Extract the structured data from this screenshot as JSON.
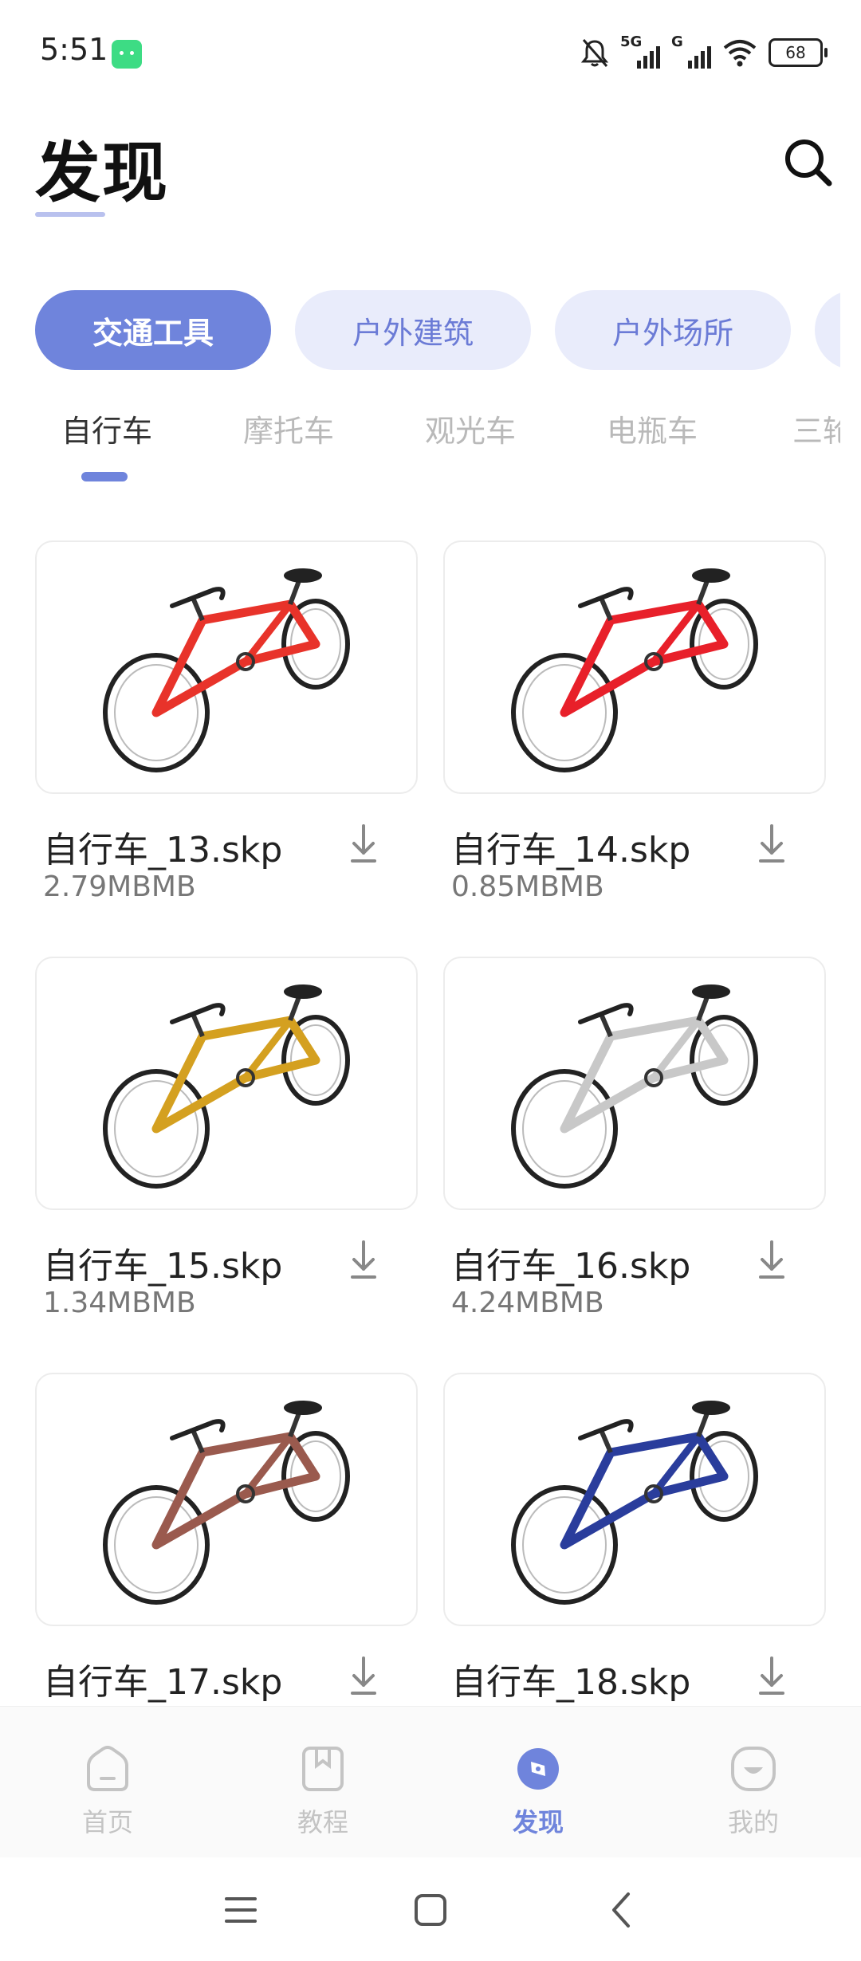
{
  "status_bar": {
    "time": "5:51",
    "sim1_label": "5G",
    "sim2_label": "G",
    "battery": "68",
    "icons": [
      "android-notification-icon",
      "mute-icon",
      "signal-icon",
      "wifi-icon",
      "battery-icon"
    ]
  },
  "header": {
    "title": "发现",
    "search_icon": "search-icon"
  },
  "categories": [
    {
      "label": "交通工具",
      "active": true
    },
    {
      "label": "户外建筑",
      "active": false
    },
    {
      "label": "户外场所",
      "active": false
    }
  ],
  "subtabs": [
    {
      "label": "自行车",
      "active": true
    },
    {
      "label": "摩托车",
      "active": false
    },
    {
      "label": "观光车",
      "active": false
    },
    {
      "label": "电瓶车",
      "active": false
    },
    {
      "label": "三轮",
      "active": false
    }
  ],
  "models": [
    {
      "name": "自行车_13.skp",
      "size": "2.79MBMB",
      "color": "#e8332a"
    },
    {
      "name": "自行车_14.skp",
      "size": "0.85MBMB",
      "color": "#e8202a"
    },
    {
      "name": "自行车_15.skp",
      "size": "1.34MBMB",
      "color": "#d4a020"
    },
    {
      "name": "自行车_16.skp",
      "size": "4.24MBMB",
      "color": "#c8c8c8"
    },
    {
      "name": "自行车_17.skp",
      "size": "",
      "color": "#9a5a4e"
    },
    {
      "name": "自行车_18.skp",
      "size": "",
      "color": "#2a3d9c"
    }
  ],
  "bottom_nav": [
    {
      "label": "首页",
      "icon": "home-icon",
      "active": false
    },
    {
      "label": "教程",
      "icon": "tutorial-icon",
      "active": false
    },
    {
      "label": "发现",
      "icon": "compass-icon",
      "active": true
    },
    {
      "label": "我的",
      "icon": "profile-icon",
      "active": false
    }
  ],
  "accent_color": "#6f84dc"
}
